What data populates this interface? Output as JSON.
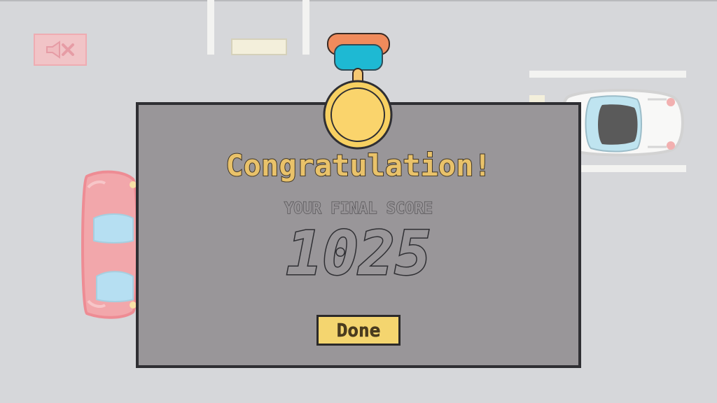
{
  "game": {
    "mute_icon": "speaker-muted-icon",
    "dialog": {
      "title": "Congratulation!",
      "subtitle": "YOUR FINAL SCORE",
      "score": "1025",
      "done_label": "Done"
    },
    "colors": {
      "background": "#d6d7da",
      "dialog_fill": "#999699",
      "dialog_border": "#2f2f33",
      "title_fill": "#e9c26a",
      "button_fill": "#f4d56f",
      "medal_gold": "#f8d36d",
      "medal_ribbon": "#1eb9d3",
      "medal_ribbon_border": "#f08b5c"
    },
    "icons": {
      "mute": "speaker-muted-icon",
      "medal": "medal-icon",
      "cars": [
        "red-car-icon",
        "white-car-icon"
      ]
    }
  }
}
